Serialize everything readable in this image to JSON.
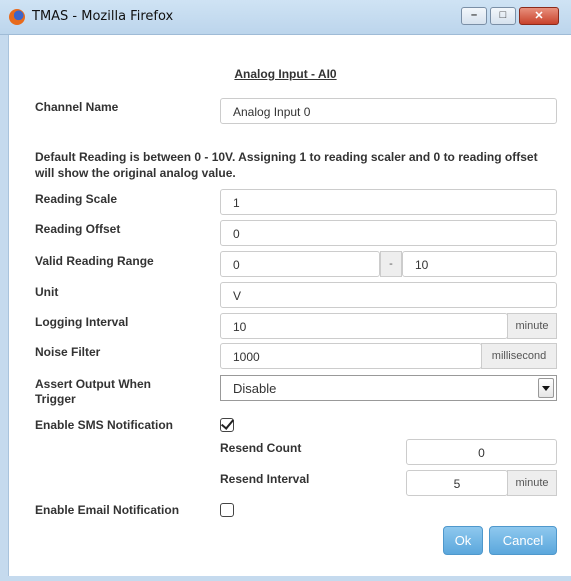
{
  "window": {
    "title": "TMAS - Mozilla Firefox",
    "buttons": {
      "minimize": "–",
      "maximize": "□",
      "close": "✕"
    }
  },
  "dialog": {
    "heading": "Analog Input - AI0",
    "info": "Default Reading is between 0 - 10V. Assigning 1 to reading scaler and 0 to reading offset will show the original analog value.",
    "fields": {
      "channel_name": {
        "label": "Channel Name",
        "value": "Analog Input 0"
      },
      "reading_scale": {
        "label": "Reading Scale",
        "value": "1"
      },
      "reading_offset": {
        "label": "Reading Offset",
        "value": "0"
      },
      "valid_reading_range": {
        "label": "Valid Reading Range",
        "min": "0",
        "separator": "-",
        "max": "10"
      },
      "unit": {
        "label": "Unit",
        "value": "V"
      },
      "logging_interval": {
        "label": "Logging Interval",
        "value": "10",
        "unit": "minute"
      },
      "noise_filter": {
        "label": "Noise Filter",
        "value": "1000",
        "unit": "millisecond"
      },
      "assert_output": {
        "label": "Assert Output When Trigger",
        "selected": "Disable"
      },
      "sms_notification": {
        "label": "Enable SMS Notification",
        "checked": true
      },
      "resend_count": {
        "label": "Resend Count",
        "value": "0"
      },
      "resend_interval": {
        "label": "Resend Interval",
        "value": "5",
        "unit": "minute"
      },
      "email_notification": {
        "label": "Enable Email Notification",
        "checked": false
      }
    },
    "actions": {
      "ok": "Ok",
      "cancel": "Cancel"
    }
  },
  "colors": {
    "accent": "#5ba7dc",
    "titlebar": "#bcd5ec",
    "close": "#c8422b"
  }
}
